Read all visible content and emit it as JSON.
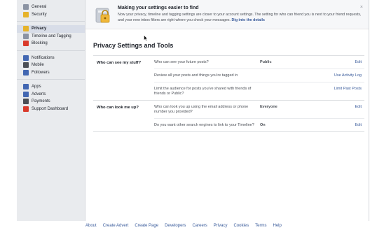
{
  "sidebar": {
    "groups": [
      [
        {
          "label": "General",
          "icon": "gear-icon",
          "color": "#8b93a3",
          "active": false
        },
        {
          "label": "Security",
          "icon": "shield-icon",
          "color": "#e6b32b",
          "active": false
        }
      ],
      [
        {
          "label": "Privacy",
          "icon": "lock-icon",
          "color": "#e6b32b",
          "active": true
        },
        {
          "label": "Timeline and Tagging",
          "icon": "timeline-icon",
          "color": "#8b93a3",
          "active": false
        },
        {
          "label": "Blocking",
          "icon": "block-icon",
          "color": "#d93a2b",
          "active": false
        }
      ],
      [
        {
          "label": "Notifications",
          "icon": "globe-icon",
          "color": "#4267b2",
          "active": false
        },
        {
          "label": "Mobile",
          "icon": "mobile-icon",
          "color": "#4b4f56",
          "active": false
        },
        {
          "label": "Followers",
          "icon": "followers-icon",
          "color": "#4267b2",
          "active": false
        }
      ],
      [
        {
          "label": "Apps",
          "icon": "apps-icon",
          "color": "#4267b2",
          "active": false
        },
        {
          "label": "Adverts",
          "icon": "adverts-icon",
          "color": "#4267b2",
          "active": false
        },
        {
          "label": "Payments",
          "icon": "payments-icon",
          "color": "#4b4f56",
          "active": false
        },
        {
          "label": "Support Dashboard",
          "icon": "support-icon",
          "color": "#d93a2b",
          "active": false
        }
      ]
    ]
  },
  "banner": {
    "title": "Making your settings easier to find",
    "body": "Now your privacy, timeline and tagging settings are closer to your account settings. The setting for who can friend you is next to your friend requests, and your new inbox filters are right where you check your messages.",
    "link": "Dig into the details",
    "close": "×"
  },
  "page_title": "Privacy Settings and Tools",
  "sections": [
    {
      "heading": "Who can see my stuff?",
      "rows": [
        {
          "question": "Who can see your future posts?",
          "value": "Public",
          "action": "Edit"
        },
        {
          "question": "Review all your posts and things you're tagged in",
          "value": "",
          "action": "Use Activity Log"
        },
        {
          "question": "Limit the audience for posts you've shared with friends of friends or Public?",
          "value": "",
          "action": "Limit Past Posts"
        }
      ]
    },
    {
      "heading": "Who can look me up?",
      "rows": [
        {
          "question": "Who can look you up using the email address or phone number you provided?",
          "value": "Everyone",
          "action": "Edit"
        },
        {
          "question": "Do you want other search engines to link to your Timeline?",
          "value": "On",
          "action": "Edit"
        }
      ]
    }
  ],
  "footer": [
    "About",
    "Create Advert",
    "Create Page",
    "Developers",
    "Careers",
    "Privacy",
    "Cookies",
    "Terms",
    "Help"
  ]
}
